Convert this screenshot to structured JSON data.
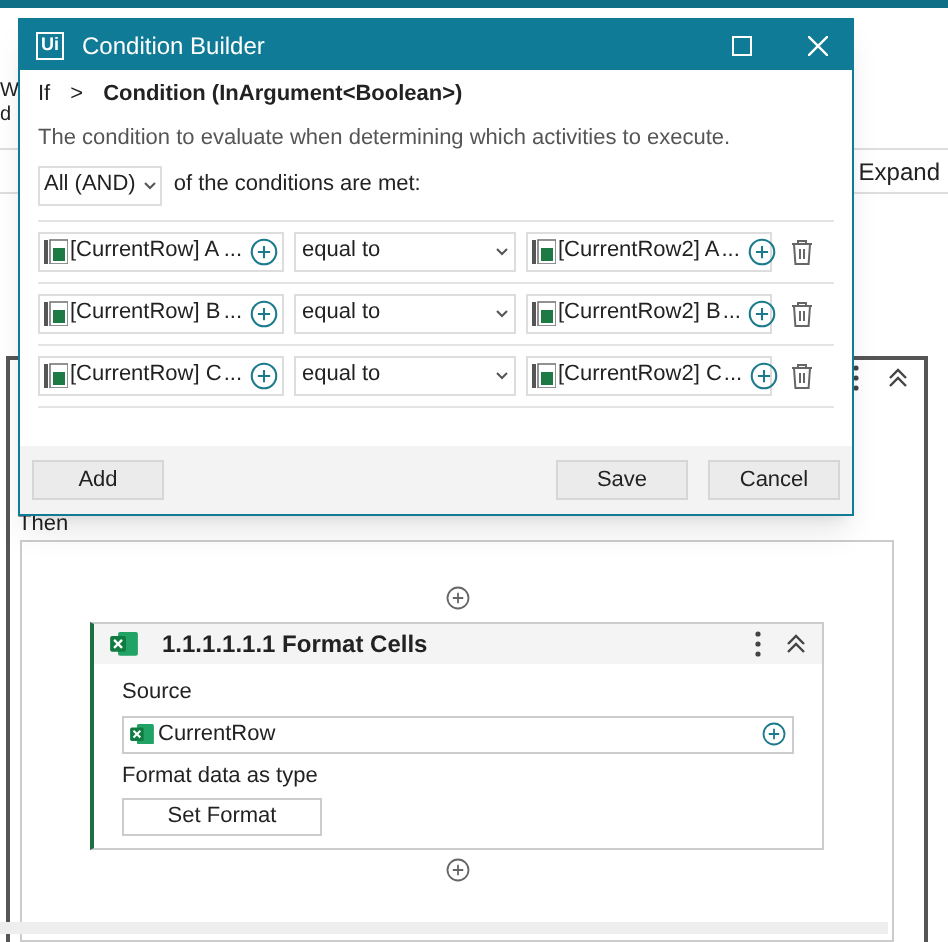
{
  "background": {
    "fragments": [
      "W",
      "d"
    ],
    "expand_button": "Expand",
    "then_label": "Then",
    "activity": {
      "title": "1.1.1.1.1.1 Format Cells",
      "source_label": "Source",
      "source_value": "CurrentRow",
      "format_label": "Format data as type",
      "format_button": "Set Format"
    }
  },
  "dialog": {
    "title": "Condition Builder",
    "logo": "Ui",
    "breadcrumb": [
      "If",
      ">",
      "Condition (InArgument<Boolean>)"
    ],
    "description": "The condition to evaluate when determining which activities to execute.",
    "quantifier": "All (AND)",
    "quantifier_suffix": "of the conditions are met:",
    "conditions": [
      {
        "left": "[CurrentRow] A",
        "left_more": "...",
        "operator": "equal to",
        "right": "[CurrentRow2] A",
        "right_more": "..."
      },
      {
        "left": "[CurrentRow] B",
        "left_more": "...",
        "operator": "equal to",
        "right": "[CurrentRow2] B",
        "right_more": "..."
      },
      {
        "left": "[CurrentRow] C",
        "left_more": "...",
        "operator": "equal to",
        "right": "[CurrentRow2] C",
        "right_more": "..."
      }
    ],
    "buttons": {
      "add": "Add",
      "save": "Save",
      "cancel": "Cancel"
    }
  }
}
